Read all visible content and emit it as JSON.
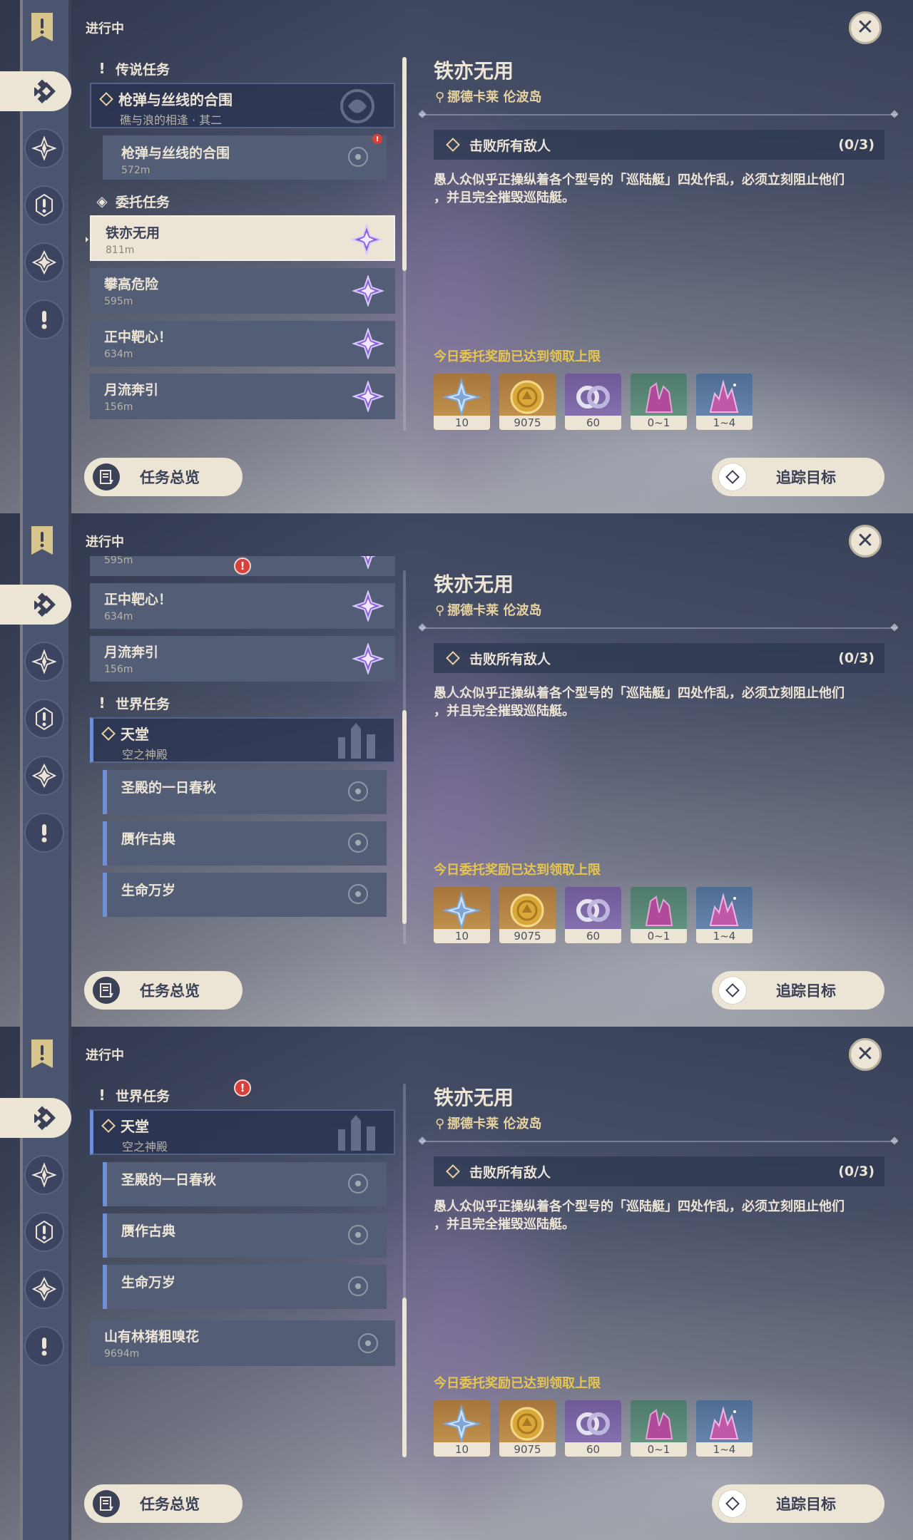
{
  "common": {
    "status_label": "进行中",
    "detail": {
      "title": "铁亦无用",
      "location": "挪德卡莱 伦波岛",
      "objective": "击败所有敌人",
      "objective_count": "(0/3)",
      "description_line1": "愚人众似乎正操纵着各个型号的「巡陆艇」四处作乱，必须立刻阻止他们",
      "description_line2": "，并且完全摧毁巡陆艇。",
      "reward_limit": "今日委托奖励已达到领取上限",
      "rewards": [
        {
          "icon": "primogem-icon",
          "qty": "10"
        },
        {
          "icon": "mora-icon",
          "qty": "9075"
        },
        {
          "icon": "companionship-exp-icon",
          "qty": "60"
        },
        {
          "icon": "crystal-chunk-icon",
          "qty": "0~1"
        },
        {
          "icon": "magical-crystal-icon",
          "qty": "1~4"
        }
      ]
    },
    "buttons": {
      "overview": "任务总览",
      "track": "追踪目标"
    }
  },
  "screens": [
    {
      "legend_category": "传说任务",
      "legend_group_title": "枪弹与丝线的合围",
      "legend_group_sub": "礁与浪的相逢 · 其二",
      "legend_sub_name": "枪弹与丝线的合围",
      "legend_sub_dist": "572m",
      "commission_category": "委托任务",
      "quests": [
        {
          "name": "铁亦无用",
          "dist": "811m"
        },
        {
          "name": "攀高危险",
          "dist": "595m"
        },
        {
          "name": "正中靶心！",
          "dist": "634m"
        },
        {
          "name": "月流奔引",
          "dist": "156m"
        }
      ]
    },
    {
      "top_partial_dist": "595m",
      "quests": [
        {
          "name": "正中靶心！",
          "dist": "634m"
        },
        {
          "name": "月流奔引",
          "dist": "156m"
        }
      ],
      "world_category": "世界任务",
      "world_group_title": "天堂",
      "world_group_sub": "空之神殿",
      "world_subs": [
        {
          "name": "圣殿的一日春秋"
        },
        {
          "name": "赝作古典"
        },
        {
          "name": "生命万岁"
        }
      ]
    },
    {
      "world_category": "世界任务",
      "world_group_title": "天堂",
      "world_group_sub": "空之神殿",
      "world_subs": [
        {
          "name": "圣殿的一日春秋"
        },
        {
          "name": "赝作古典"
        },
        {
          "name": "生命万岁"
        }
      ],
      "extra_quest": {
        "name": "山有林猪粗嗅花",
        "dist": "9694m"
      }
    }
  ]
}
